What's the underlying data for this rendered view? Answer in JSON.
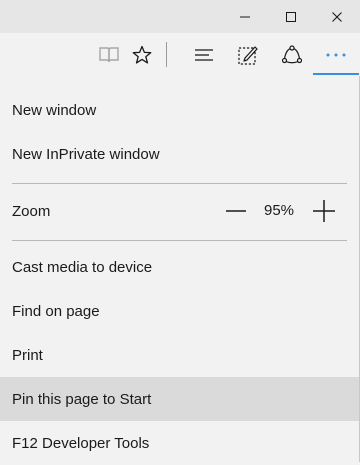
{
  "window_controls": {
    "minimize_icon": "minimize-icon",
    "maximize_icon": "maximize-icon",
    "close_icon": "close-icon"
  },
  "toolbar": {
    "icons": [
      "reading-view-icon",
      "favorite-star-icon",
      "hub-icon",
      "web-note-icon",
      "share-icon",
      "more-actions-icon"
    ],
    "accent_color": "#3b8ede"
  },
  "menu": {
    "new_window": "New window",
    "new_inprivate": "New InPrivate window",
    "zoom_label": "Zoom",
    "zoom_value": "95%",
    "cast_media": "Cast media to device",
    "find_on_page": "Find on page",
    "print": "Print",
    "pin_to_start": "Pin this page to Start",
    "dev_tools": "F12 Developer Tools"
  }
}
